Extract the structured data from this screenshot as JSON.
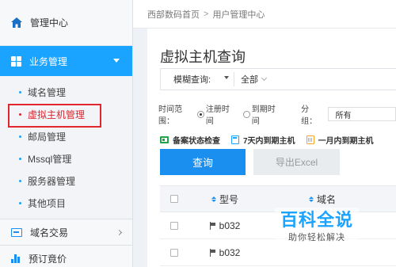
{
  "sidebar": {
    "home_label": "管理中心",
    "active_section": "业务管理",
    "sub_items": [
      {
        "label": "域名管理"
      },
      {
        "label": "虚拟主机管理"
      },
      {
        "label": "邮局管理"
      },
      {
        "label": "Mssql管理"
      },
      {
        "label": "服务器管理"
      },
      {
        "label": "其他项目"
      }
    ],
    "section_domain_trade": "域名交易",
    "section_presale": "预订竟价"
  },
  "breadcrumb": {
    "home": "西部数码首页",
    "separator": ">",
    "current": "用户管理中心"
  },
  "page": {
    "title": "虚拟主机查询"
  },
  "filter": {
    "label": "模糊查询:",
    "value": "全部"
  },
  "time_range": {
    "label": "时间范围：",
    "option_register": "注册时间",
    "option_expire": "到期时间",
    "group_label": "分组：",
    "group_value": "所有"
  },
  "quick_links": {
    "record_check": "备案状态检查",
    "expire_7days": "7天内到期主机",
    "expire_1month": "一月内到期主机"
  },
  "buttons": {
    "query": "查询",
    "export": "导出Excel"
  },
  "table": {
    "col_type": "型号",
    "col_domain": "域名",
    "rows": [
      {
        "type": "b032"
      },
      {
        "type": "b032"
      }
    ]
  },
  "watermark": {
    "main": "百科全说",
    "sub": "助你轻松解决"
  },
  "colors": {
    "accent": "#1aa3ff",
    "primary_button": "#1a8ff0",
    "highlight_box": "#e3262d"
  }
}
